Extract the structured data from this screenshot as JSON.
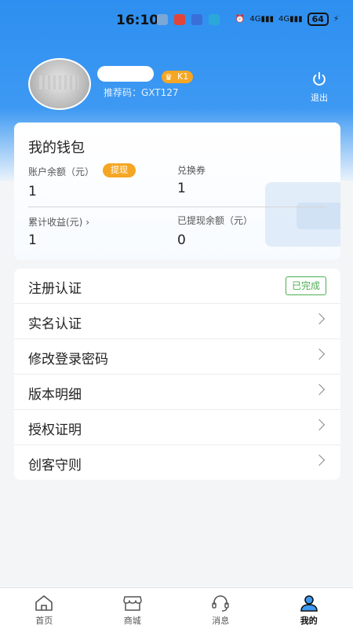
{
  "status_bar": {
    "time": "16:10",
    "battery": "64",
    "network": "4G"
  },
  "profile": {
    "level": "K1",
    "referral": "推荐码：GXT127",
    "logout_label": "退出"
  },
  "wallet": {
    "title": "我的钱包",
    "balance_label": "账户余额（元）",
    "withdraw_label": "提现",
    "balance_value": "1",
    "voucher_label": "兑换券",
    "voucher_value": "1",
    "earnings_label": "累计收益(元)",
    "earnings_value": "1",
    "withdrawn_label": "已提现余额（元）",
    "withdrawn_value": "0"
  },
  "menu": {
    "items": [
      {
        "label": "注册认证",
        "badge": "已完成"
      },
      {
        "label": "实名认证"
      },
      {
        "label": "修改登录密码"
      },
      {
        "label": "版本明细"
      },
      {
        "label": "授权证明"
      },
      {
        "label": "创客守则"
      }
    ]
  },
  "tabbar": {
    "tabs": [
      {
        "label": "首页",
        "icon": "home-icon"
      },
      {
        "label": "商城",
        "icon": "shop-icon"
      },
      {
        "label": "消息",
        "icon": "headset-icon"
      },
      {
        "label": "我的",
        "icon": "user-icon"
      }
    ],
    "active_index": 3
  },
  "colors": {
    "accent": "#2e8ff0",
    "badge_orange": "#f5a623",
    "done_green": "#4caf50"
  }
}
